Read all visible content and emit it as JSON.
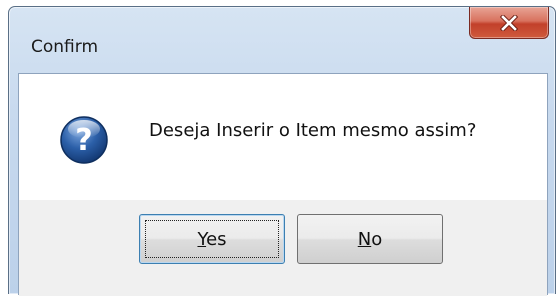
{
  "window": {
    "title": "Confirm",
    "close_button_icon": "close-icon"
  },
  "dialog": {
    "icon": "question-icon",
    "message": "Deseja Inserir o Item mesmo assim?"
  },
  "buttons": {
    "yes": {
      "mnemonic": "Y",
      "rest": "es"
    },
    "no": {
      "mnemonic": "N",
      "rest": "o"
    }
  },
  "colors": {
    "title_bar": "#c7d9ee",
    "close_button": "#c7432e",
    "content_background": "#ffffff",
    "button_bar_background": "#f0f0f0",
    "default_button_border": "#3c7fb1",
    "question_icon": "#2b5fa8"
  }
}
